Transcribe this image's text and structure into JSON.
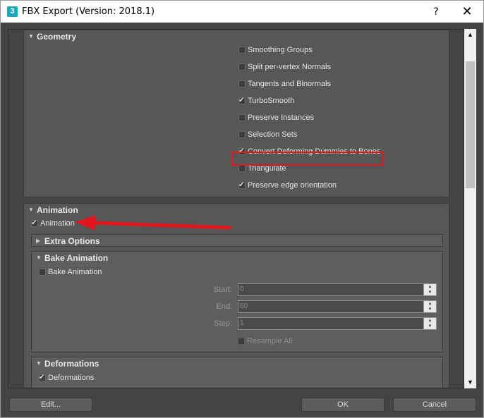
{
  "window": {
    "title": "FBX Export (Version: 2018.1)",
    "app_icon": "3",
    "help_label": "?",
    "close_label": "✕"
  },
  "geometry": {
    "title": "Geometry",
    "options": [
      {
        "label": "Smoothing Groups",
        "checked": false
      },
      {
        "label": "Split per-vertex Normals",
        "checked": false
      },
      {
        "label": "Tangents and Binormals",
        "checked": false
      },
      {
        "label": "TurboSmooth",
        "checked": true
      },
      {
        "label": "Preserve Instances",
        "checked": false
      },
      {
        "label": "Selection Sets",
        "checked": false
      },
      {
        "label": "Convert Deforming Dummies to Bones",
        "checked": true
      },
      {
        "label": "Triangulate",
        "checked": false
      },
      {
        "label": "Preserve edge orientation",
        "checked": true
      }
    ]
  },
  "animation": {
    "title": "Animation",
    "enable_label": "Animation",
    "enable_checked": true,
    "extra_options_title": "Extra Options",
    "bake": {
      "title": "Bake Animation",
      "enable_label": "Bake Animation",
      "start_label": "Start:",
      "start_value": "0",
      "end_label": "End:",
      "end_value": "60",
      "step_label": "Step:",
      "step_value": "1",
      "resample_label": "Resample All"
    },
    "deformations": {
      "title": "Deformations",
      "enable_label": "Deformations",
      "enable_checked": true
    }
  },
  "footer": {
    "edit_label": "Edit...",
    "ok_label": "OK",
    "cancel_label": "Cancel"
  },
  "colors": {
    "panel_bg": "#444444",
    "section_bg": "#575757",
    "highlight": "#e2161c"
  }
}
